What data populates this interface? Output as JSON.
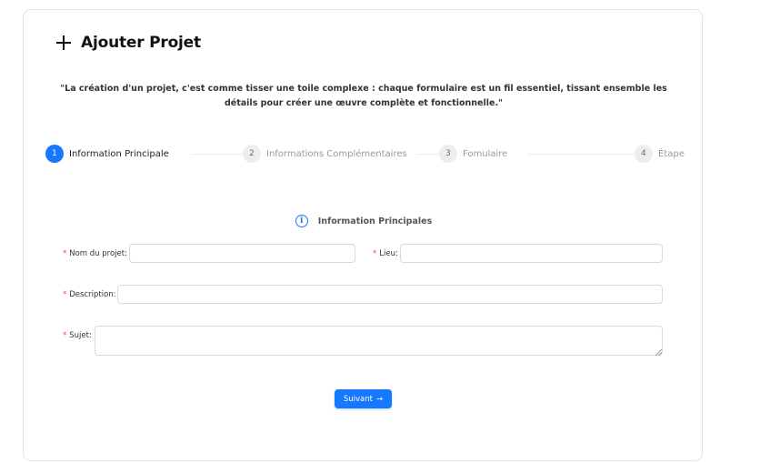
{
  "header": {
    "title": "Ajouter Projet",
    "icon": "plus-icon"
  },
  "quote": "\"La création d'un projet, c'est comme tisser une toile complexe : chaque formulaire est un fil essentiel, tissant ensemble les détails pour créer une œuvre complète et fonctionnelle.\"",
  "steps": [
    {
      "number": "1",
      "label": "Information Principale",
      "active": true
    },
    {
      "number": "2",
      "label": "Informations Complémentaires",
      "active": false
    },
    {
      "number": "3",
      "label": "Fomulaire",
      "active": false
    },
    {
      "number": "4",
      "label": "Étape",
      "active": false
    }
  ],
  "section": {
    "title": "Information Principales",
    "icon": "info-icon"
  },
  "form": {
    "required_mark": "*",
    "nom_label": "Nom du projet",
    "nom_value": "",
    "lieu_label": "Lieu",
    "lieu_value": "",
    "description_label": "Description",
    "description_value": "",
    "sujet_label": "Sujet",
    "sujet_value": "",
    "colon": ":"
  },
  "buttons": {
    "next_label": "Suivant",
    "next_icon": "arrow-right-icon",
    "next_arrow": "→"
  },
  "colors": {
    "primary": "#1677ff",
    "required": "#e5484d",
    "border": "#d9d9d9"
  }
}
